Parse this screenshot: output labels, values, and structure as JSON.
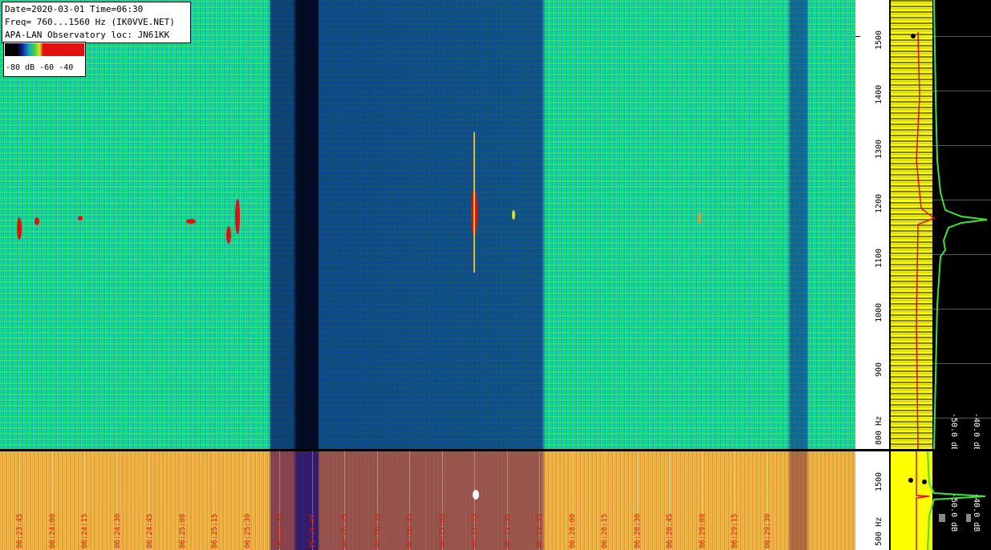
{
  "info": {
    "line1": "Date=2020-03-01 Time=06:30",
    "line2": "Freq= 760...1560 Hz (IK0VVE.NET)",
    "line3": "APA-LAN Observatory loc: JN61KK"
  },
  "legend": {
    "labels": "-80 dB -60    -40"
  },
  "axis_top": {
    "ticks": [
      "1500",
      "1400",
      "1300",
      "1200",
      "1100",
      "1000",
      "900",
      "800 Hz"
    ]
  },
  "axis_bottom": {
    "ticks": [
      "1500",
      "500 Hz"
    ]
  },
  "spectrum_top": {
    "db_labels": [
      "-50.0 dB",
      "-40.0 dB"
    ]
  },
  "spectrum_bottom": {
    "db_labels": [
      "-50.0 dB",
      "-40.0 dB"
    ]
  },
  "time_labels": [
    "06:23:45",
    "06:24:00",
    "06:24:15",
    "06:24:30",
    "06:24:45",
    "06:25:00",
    "06:25:15",
    "06:25:30",
    "06:25:45",
    "06:26:00",
    "06:26:15",
    "06:26:30",
    "06:26:45",
    "06:27:00",
    "06:27:15",
    "06:27:30",
    "06:27:45",
    "06:28:00",
    "06:28:15",
    "06:28:30",
    "06:28:45",
    "06:29:00",
    "06:29:15",
    "06:29:30"
  ],
  "colors": {
    "signal": "#e01010",
    "time_label": "#d02000",
    "spectrum_trace": "#ffff00",
    "spectrum_peak": "#40e040"
  }
}
